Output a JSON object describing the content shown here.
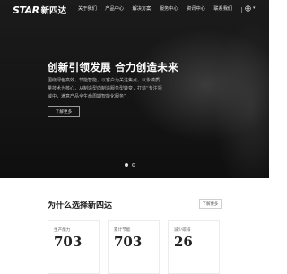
{
  "brand": {
    "logo_mark": "STAR",
    "logo_text": "新四达"
  },
  "nav": {
    "items": [
      {
        "label": "关于我们"
      },
      {
        "label": "产品中心"
      },
      {
        "label": "解决方案"
      },
      {
        "label": "服务中心"
      },
      {
        "label": "资讯中心"
      },
      {
        "label": "联系我们"
      }
    ],
    "language_icon": "globe-icon"
  },
  "hero": {
    "title": "创新引领发展  合力创造未来",
    "description": "围绕绿色高效，节能智能，以客户为关注焦点，以永葆质量技术为核心，从制造型向制造服务型转变，打造“专注领域中，满意产品全生命周期智能化服务”",
    "button_label": "了解更多",
    "carousel": {
      "count": 2,
      "active_index": 0
    }
  },
  "why": {
    "title": "为什么选择新四达",
    "button_label": "了解更多",
    "stats": [
      {
        "label": "生产能力",
        "value": "703"
      },
      {
        "label": "累计节能",
        "value": "703"
      },
      {
        "label": "减少碳排",
        "value": "26"
      }
    ]
  }
}
